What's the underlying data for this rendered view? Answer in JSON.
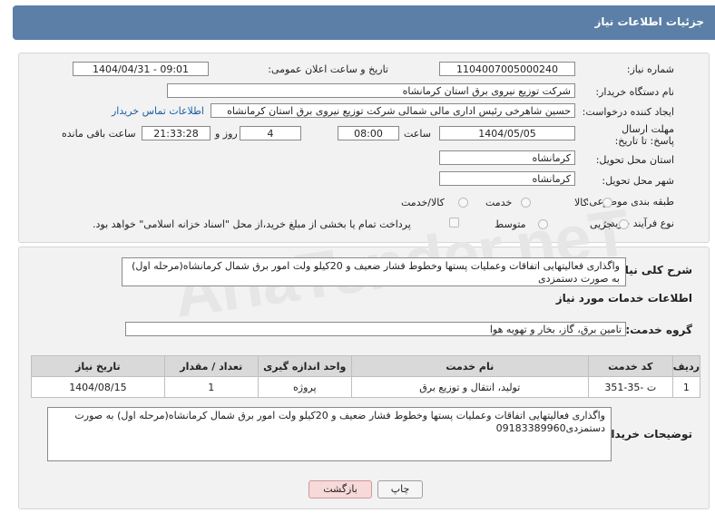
{
  "header": {
    "title": "جزئیات اطلاعات نیاز"
  },
  "form": {
    "need_number_label": "شماره نیاز:",
    "need_number": "1104007005000240",
    "announce_label": "تاریخ و ساعت اعلان عمومی:",
    "announce_value": "1404/04/31 - 09:01",
    "buyer_org_label": "نام دستگاه خریدار:",
    "buyer_org": "شرکت توزیع نیروی برق استان کرمانشاه",
    "creator_label": "ایجاد کننده درخواست:",
    "creator": "حسین شاهرخی رئیس اداری مالی شمالی شرکت توزیع نیروی برق استان کرمانشاه",
    "contact_link": "اطلاعات تماس خریدار",
    "deadline_label": "مهلت ارسال پاسخ: تا تاریخ:",
    "deadline_date": "1404/05/05",
    "time_label": "ساعت",
    "deadline_time": "08:00",
    "days_value": "4",
    "days_label": "روز و",
    "remaining_time": "21:33:28",
    "remaining_label": "ساعت باقی مانده",
    "province_label": "استان محل تحویل:",
    "province": "کرمانشاه",
    "city_label": "شهر محل تحویل:",
    "city": "کرمانشاه",
    "category_label": "طبقه بندی موضوعی:",
    "category_options": [
      "کالا",
      "خدمت",
      "کالا/خدمت"
    ],
    "process_label": "نوع فرآیند خرید :",
    "process_options": [
      "جزیی",
      "متوسط"
    ],
    "payment_note": "پرداخت تمام یا بخشی از مبلغ خرید،از محل \"اسناد خزانه اسلامی\" خواهد بود."
  },
  "details": {
    "summary_label": "شرح کلی نیاز:",
    "summary": "واگذاری فعالیتهایی اتفاقات وعملیات  پستها وخطوط فشار ضعیف و 20کیلو ولت امور برق شمال کرمانشاه(مرحله اول) به صورت دستمزدی",
    "services_title": "اطلاعات خدمات مورد نیاز",
    "service_group_label": "گروه خدمت:",
    "service_group": "تامین برق، گاز، بخار و تهویه هوا"
  },
  "table": {
    "headers": [
      "ردیف",
      "کد خدمت",
      "نام خدمت",
      "واحد اندازه گیری",
      "تعداد / مقدار",
      "تاریخ نیاز"
    ],
    "rows": [
      [
        "1",
        "ت -35-351",
        "تولید، انتقال و توزیع برق",
        "پروژه",
        "1",
        "1404/08/15"
      ]
    ]
  },
  "buyer_notes": {
    "label": "توضیحات خریدار:",
    "text": "واگذاری فعالیتهایی اتفاقات وعملیات  پستها وخطوط فشار ضعیف و 20کیلو ولت امور برق شمال کرمانشاه(مرحله اول) به صورت دستمزدی09183389960"
  },
  "buttons": {
    "print": "چاپ",
    "back": "بازگشت"
  },
  "watermark": "AriaTender.neT"
}
